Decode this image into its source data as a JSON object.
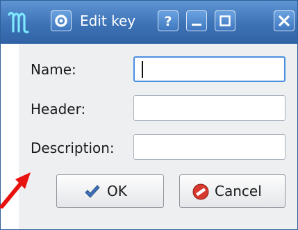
{
  "window": {
    "title": "Edit key",
    "icons": {
      "logo": "mv-logo-icon",
      "settings": "gear-icon",
      "help": "help-icon",
      "minimize": "minimize-icon",
      "maximize": "maximize-icon",
      "close": "close-icon"
    },
    "help_glyph": "?",
    "accent_color": "#3d73b6"
  },
  "form": {
    "name_label": "Name:",
    "name_value": "",
    "header_label": "Header:",
    "header_value": "",
    "description_label": "Description:",
    "description_value": ""
  },
  "buttons": {
    "ok_label": "OK",
    "ok_icon": "checkmark-icon",
    "cancel_label": "Cancel",
    "cancel_icon": "no-entry-icon"
  },
  "annotation": {
    "arrow_icon": "red-arrow-icon",
    "arrow_color": "#e8120f"
  }
}
